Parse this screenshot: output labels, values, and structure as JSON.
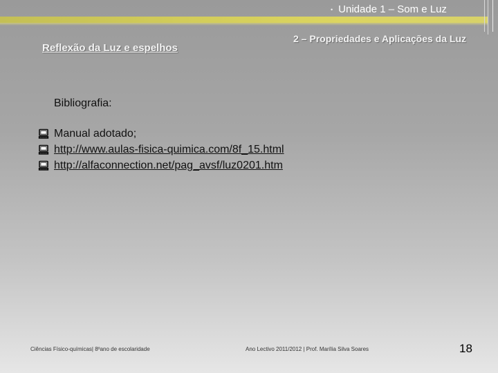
{
  "header": {
    "bullet": "•",
    "title": "Unidade 1 – Som e Luz"
  },
  "section_title": "2 – Propriedades e Aplicações da Luz",
  "subtitle": "Reflexão da Luz e espelhos",
  "bibliography": {
    "heading": "Bibliografia:",
    "items": [
      {
        "icon": "computer-icon",
        "text": "Manual adotado;"
      },
      {
        "icon": "computer-icon",
        "text": "http://www.aulas-fisica-quimica.com/8f_15.html"
      },
      {
        "icon": "computer-icon",
        "text": "http://alfaconnection.net/pag_avsf/luz0201.htm"
      }
    ]
  },
  "footer": {
    "left": "Ciências Físico-químicas| 8ºano de escolaridade",
    "center": "Ano Lectivo 2011/2012 | Prof. Marília Silva Soares",
    "page_number": "18"
  },
  "colors": {
    "gold_bar": "#d3cd5a",
    "background_top": "#9a9a9a",
    "background_bottom": "#e6e6e6"
  }
}
